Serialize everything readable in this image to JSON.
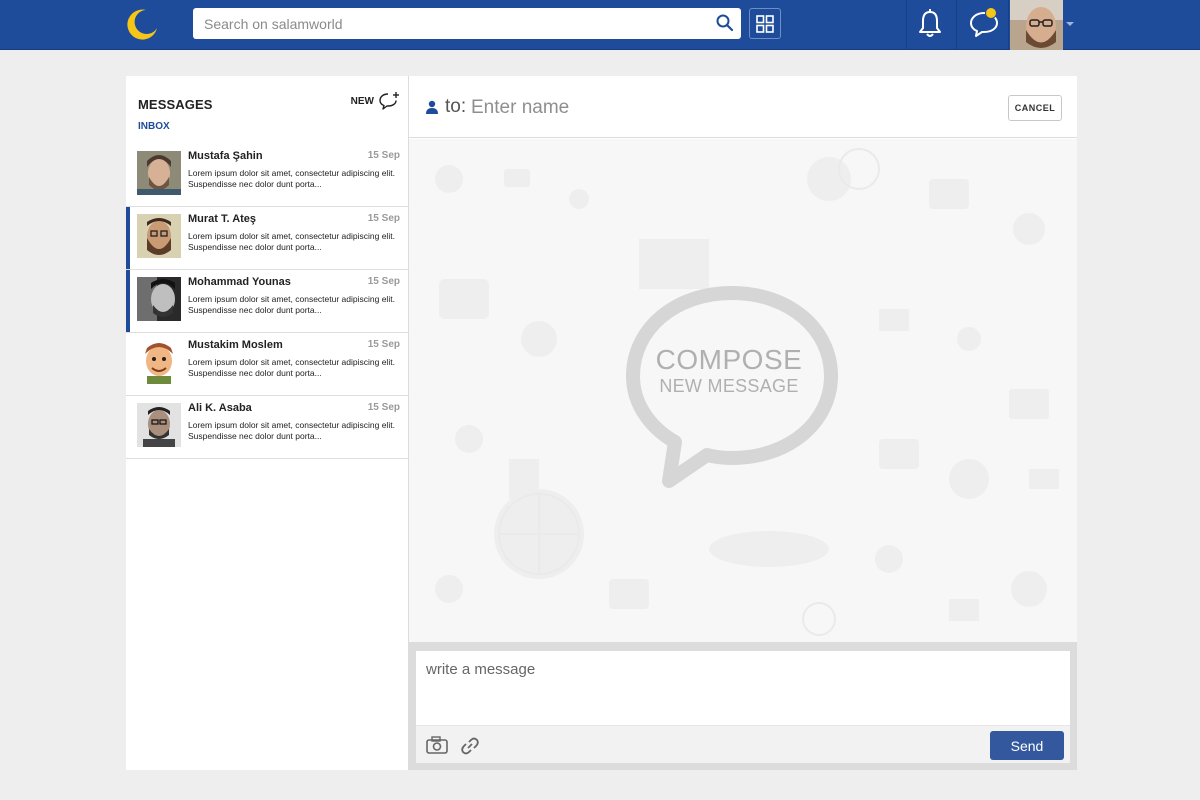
{
  "header": {
    "search_placeholder": "Search on salamworld"
  },
  "sidebar": {
    "title": "MESSAGES",
    "subtitle": "INBOX",
    "new_label": "NEW",
    "messages": [
      {
        "name": "Mustafa Şahin",
        "date": "15 Sep",
        "preview": "Lorem ipsum dolor sit amet, consectetur adipiscing elit. Suspendisse nec dolor dunt porta...",
        "active": false
      },
      {
        "name": "Murat T. Ateş",
        "date": "15 Sep",
        "preview": "Lorem ipsum dolor sit amet, consectetur adipiscing elit. Suspendisse nec dolor dunt porta...",
        "active": true
      },
      {
        "name": "Mohammad Younas",
        "date": "15 Sep",
        "preview": "Lorem ipsum dolor sit amet, consectetur adipiscing elit. Suspendisse nec dolor dunt porta...",
        "active": true
      },
      {
        "name": "Mustakim Moslem",
        "date": "15 Sep",
        "preview": "Lorem ipsum dolor sit amet, consectetur adipiscing elit. Suspendisse nec dolor dunt porta...",
        "active": false
      },
      {
        "name": "Ali K. Asaba",
        "date": "15 Sep",
        "preview": "Lorem ipsum dolor sit amet, consectetur adipiscing elit. Suspendisse nec dolor dunt porta...",
        "active": false
      }
    ]
  },
  "compose": {
    "to_label": "to:",
    "to_placeholder": "Enter name",
    "cancel_label": "CANCEL",
    "art_line1": "COMPOSE",
    "art_line2": "NEW MESSAGE",
    "message_placeholder": "write a message",
    "send_label": "Send"
  },
  "colors": {
    "brand": "#1e4c9a",
    "accent": "#f5c518",
    "send": "#33589e"
  },
  "icons": [
    "moon-logo-icon",
    "search-icon",
    "apps-grid-icon",
    "bell-icon",
    "chat-bubble-icon",
    "caret-down-icon",
    "new-message-icon",
    "user-icon",
    "compose-bubble-icon",
    "camera-icon",
    "link-icon"
  ]
}
